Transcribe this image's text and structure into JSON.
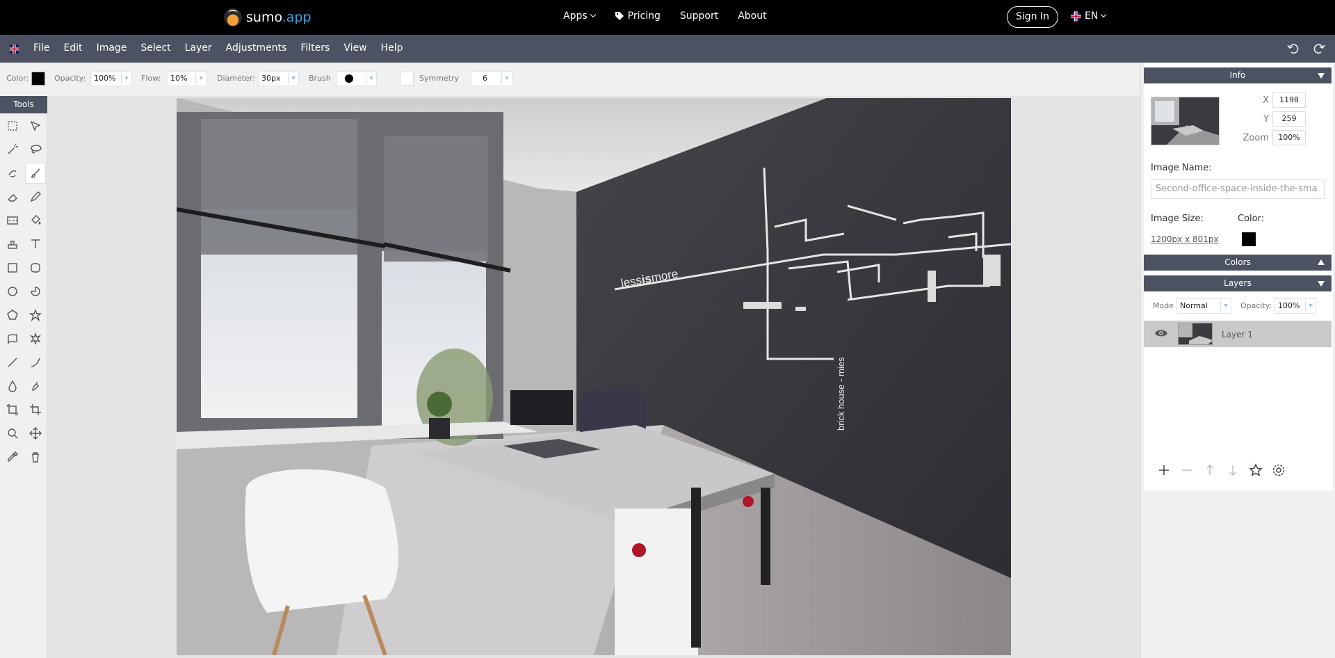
{
  "site_nav": {
    "logo_brand": "sumo",
    "logo_suffix": ".app",
    "items": [
      {
        "label": "Apps",
        "has_dropdown": true
      },
      {
        "label": "Pricing",
        "icon": "tag-icon"
      },
      {
        "label": "Support"
      },
      {
        "label": "About"
      }
    ],
    "sign_in": "Sign In",
    "language": "EN"
  },
  "menubar": {
    "items": [
      "File",
      "Edit",
      "Image",
      "Select",
      "Layer",
      "Adjustments",
      "Filters",
      "View",
      "Help"
    ]
  },
  "options": {
    "color_label": "Color:",
    "opacity_label": "Opacity:",
    "opacity_value": "100%",
    "flow_label": "Flow:",
    "flow_value": "10%",
    "diameter_label": "Diameter:",
    "diameter_value": "30px",
    "brush_label": "Brush",
    "symmetry_label": "Symmetry",
    "symmetry_value": "6"
  },
  "tools": {
    "title": "Tools",
    "active": "brush-tool"
  },
  "info": {
    "title": "Info",
    "x_label": "X",
    "x_value": "1198",
    "y_label": "Y",
    "y_value": "259",
    "zoom_label": "Zoom",
    "zoom_value": "100%",
    "image_name_label": "Image Name:",
    "image_name_value": "Second-office-space-inside-the-sma",
    "image_size_label": "Image Size:",
    "image_size_value": "1200px x 801px",
    "color_label": "Color:",
    "color_value": "#000000"
  },
  "colors_panel": {
    "title": "Colors"
  },
  "layers_panel": {
    "title": "Layers",
    "mode_label": "Mode",
    "mode_value": "Normal",
    "opacity_label": "Opacity:",
    "opacity_value": "100%",
    "layers": [
      {
        "name": "Layer 1",
        "visible": true
      }
    ]
  },
  "photo": {
    "wall_text": "lessismore",
    "wall_text_bold": "is",
    "wall_caption": "brick house - mies"
  },
  "colors": {
    "topnav_bg": "#000000",
    "menubar_bg": "#4c5262",
    "accent": "#3aa6f0"
  }
}
